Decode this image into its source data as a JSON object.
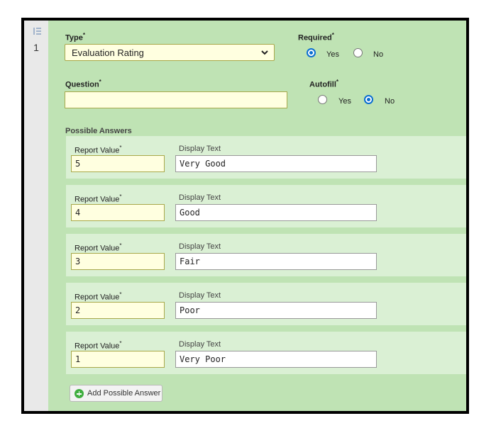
{
  "row_number": "1",
  "type": {
    "label": "Type",
    "selected": "Evaluation Rating"
  },
  "required": {
    "label": "Required",
    "yes": "Yes",
    "no": "No",
    "value": "Yes"
  },
  "question": {
    "label": "Question",
    "value": ""
  },
  "autofill": {
    "label": "Autofill",
    "yes": "Yes",
    "no": "No",
    "value": "No"
  },
  "required_mark": "*",
  "possible_answers": {
    "label": "Possible Answers",
    "report_value_label": "Report Value",
    "display_text_label": "Display Text",
    "items": [
      {
        "report_value": "5",
        "display_text": "Very Good"
      },
      {
        "report_value": "4",
        "display_text": "Good"
      },
      {
        "report_value": "3",
        "display_text": "Fair"
      },
      {
        "report_value": "2",
        "display_text": "Poor"
      },
      {
        "report_value": "1",
        "display_text": "Very Poor"
      }
    ]
  },
  "add_button_label": "Add Possible Answer",
  "colors": {
    "panel": "#bfe3b4",
    "answer_row": "#daf0d4",
    "field_bg": "#ffffe0",
    "radio_on": "#0a6ed1"
  },
  "icons": {
    "gutter": "list-order-icon",
    "add": "add-circle-icon",
    "select": "chevron-down-icon"
  }
}
